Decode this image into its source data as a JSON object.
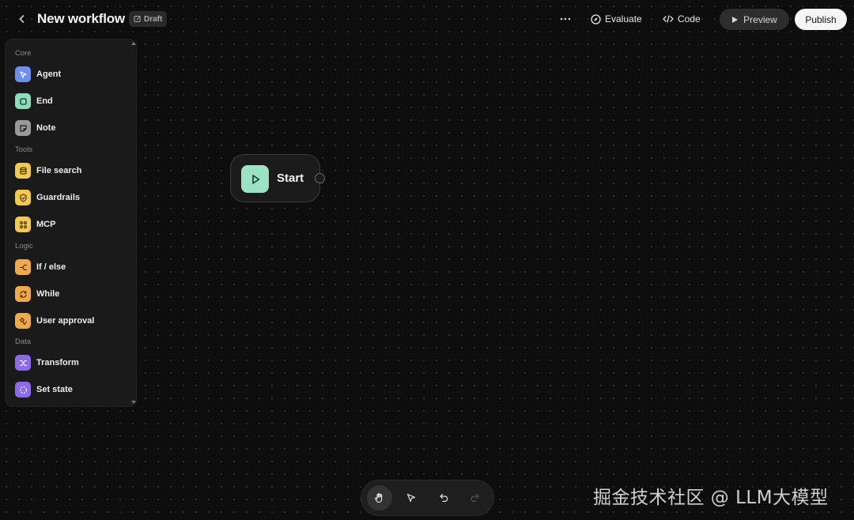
{
  "header": {
    "title": "New workflow",
    "draft_label": "Draft",
    "evaluate_label": "Evaluate",
    "code_label": "Code",
    "preview_label": "Preview",
    "publish_label": "Publish"
  },
  "palette": {
    "sections": [
      {
        "label": "Core",
        "items": [
          {
            "label": "Agent",
            "icon": "cursor-arrow-icon",
            "color": "#6e8ff0"
          },
          {
            "label": "End",
            "icon": "stop-square-icon",
            "color": "#8fdcbc"
          },
          {
            "label": "Note",
            "icon": "note-icon",
            "color": "#9a9a9a"
          }
        ]
      },
      {
        "label": "Tools",
        "items": [
          {
            "label": "File search",
            "icon": "database-icon",
            "color": "#f2c94c"
          },
          {
            "label": "Guardrails",
            "icon": "shield-icon",
            "color": "#f2c94c"
          },
          {
            "label": "MCP",
            "icon": "command-icon",
            "color": "#f2c94c"
          }
        ]
      },
      {
        "label": "Logic",
        "items": [
          {
            "label": "If / else",
            "icon": "branch-icon",
            "color": "#f0a94a"
          },
          {
            "label": "While",
            "icon": "loop-icon",
            "color": "#f0a94a"
          },
          {
            "label": "User approval",
            "icon": "approval-icon",
            "color": "#f0a94a"
          }
        ]
      },
      {
        "label": "Data",
        "items": [
          {
            "label": "Transform",
            "icon": "shuffle-icon",
            "color": "#8b6bea"
          },
          {
            "label": "Set state",
            "icon": "dashed-circle-icon",
            "color": "#8b6bea"
          }
        ]
      }
    ]
  },
  "canvas": {
    "start_node": {
      "label": "Start",
      "icon": "play-icon",
      "color": "#9be3c4"
    }
  },
  "toolbar": {
    "tools": [
      {
        "name": "hand-icon",
        "active": true
      },
      {
        "name": "pointer-icon",
        "active": false
      },
      {
        "name": "undo-icon",
        "active": false
      },
      {
        "name": "redo-icon",
        "active": false,
        "disabled": true
      }
    ]
  },
  "watermark": "掘金技术社区 @ LLM大模型"
}
